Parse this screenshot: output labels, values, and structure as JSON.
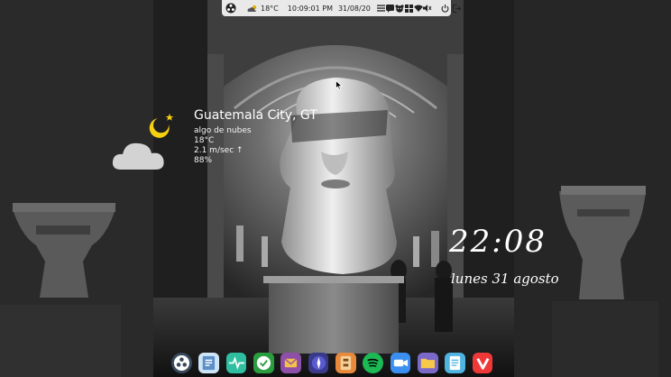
{
  "panel": {
    "temperature": "18°C",
    "time": "10:09:01 PM",
    "date": "31/08/20",
    "icons": [
      "system-menu-icon",
      "cloud-icon",
      "menu-lines-icon",
      "chat-bubble-icon",
      "bear-face-icon",
      "grid-icon",
      "wifi-icon",
      "volume-icon",
      "power-icon",
      "logout-icon"
    ]
  },
  "weather": {
    "city": "Guatemala City, GT",
    "condition": "algo de nubes",
    "temperature": "18°C",
    "wind": "2.1 m/sec ↑",
    "humidity": "88%"
  },
  "clock": {
    "time": "22:08",
    "date": "lunes 31 agosto"
  },
  "dock": {
    "apps": [
      {
        "icon": "launchpad-icon",
        "color": "#3a4a5c"
      },
      {
        "icon": "files-icon",
        "color": "#cfe4f7"
      },
      {
        "icon": "system-monitor-icon",
        "color": "#2fbfa0"
      },
      {
        "icon": "software-center-icon",
        "color": "#2a9d3f"
      },
      {
        "icon": "mail-icon",
        "color": "#8e4fa8"
      },
      {
        "icon": "compass-icon",
        "color": "#3a3a8a"
      },
      {
        "icon": "archive-manager-icon",
        "color": "#e88a3c"
      },
      {
        "icon": "spotify-icon",
        "color": "#1db954"
      },
      {
        "icon": "video-call-icon",
        "color": "#3b8ff0"
      },
      {
        "icon": "folder-icon",
        "color": "#7a69c9"
      },
      {
        "icon": "text-editor-icon",
        "color": "#4fb4e0"
      },
      {
        "icon": "vivaldi-icon",
        "color": "#ef3939"
      }
    ]
  },
  "colors": {
    "panel_bg": "#e9e9e9",
    "moon": "#f4d011",
    "cloud": "#d3d3d3"
  }
}
